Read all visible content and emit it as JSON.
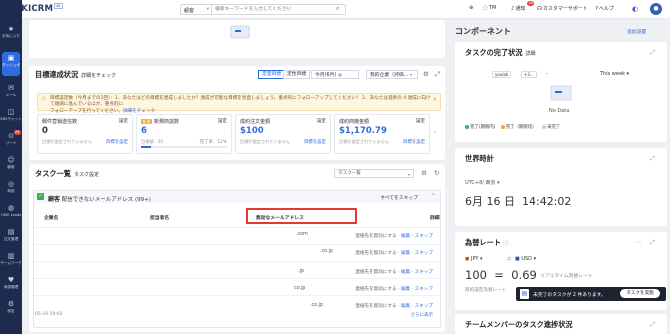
{
  "app": {
    "logo": "OKKICRM",
    "logo_badge": "AI"
  },
  "search": {
    "scope": "顧客",
    "placeholder": "検索キーワードを入力してください"
  },
  "topbar": {
    "tm": "TM",
    "notifications": "通知",
    "notification_count": "30",
    "support": "カスタマーサポート",
    "help": "ヘルプ"
  },
  "sidebar": {
    "items": [
      {
        "label": "お気に入り",
        "icon": "star-icon"
      },
      {
        "label": "ダッシュボード",
        "icon": "dashboard-icon"
      },
      {
        "label": "メール",
        "icon": "mail-icon"
      },
      {
        "label": "SNSチャット",
        "icon": "chat-icon"
      },
      {
        "label": "リード",
        "icon": "lead-icon",
        "badge": "25"
      },
      {
        "label": "顧客",
        "icon": "customer-icon"
      },
      {
        "label": "商談",
        "icon": "deal-icon"
      },
      {
        "label": "OKKI Leads",
        "icon": "leads-icon"
      },
      {
        "label": "注文管理",
        "icon": "order-icon"
      },
      {
        "label": "チームワーク",
        "icon": "team-icon"
      },
      {
        "label": "承認管理",
        "icon": "approval-icon"
      },
      {
        "label": "設定",
        "icon": "settings-icon"
      }
    ]
  },
  "goals": {
    "title": "目標達成状況",
    "subtitle": "詳細をチェック",
    "tabs": [
      "定量目標",
      "定性目標"
    ],
    "period": "今月(6月)",
    "company": "我的企業（評価...",
    "notice_line1": "目標設定数（今月までの1回）：1、あなたはどの目標を達成しましたか？達成が可能な目標を見直しましょう。重点的にフォローアップしてください！ 2、あなたは進捗の 4 達成に向けて順調に進んでいるほか、重点的に",
    "notice_line2": "フォローアップを行ってください。",
    "notice_link": "詳細をチェック",
    "metrics": [
      {
        "name": "郵件营销送信数",
        "new": false,
        "value": "0",
        "note": "目標が設定されていません",
        "link": "目標を設定",
        "settings": "設定",
        "progress": 0
      },
      {
        "name": "新規商談数",
        "new": true,
        "new_label": "新規",
        "value": "6",
        "note": "目標値：50",
        "progress_label": "完了率：12%",
        "settings": "設定",
        "progress": 0.12
      },
      {
        "name": "成約注文金額",
        "new": false,
        "value": "$100",
        "note": "目標が設定されていません",
        "link": "目標を設定",
        "settings": "設定",
        "progress": 0
      },
      {
        "name": "成約商機金額",
        "new": false,
        "value": "$1,170.79",
        "note": "目標が設定されていません",
        "link": "目標を設定",
        "settings": "設定",
        "progress": 0
      }
    ]
  },
  "tasks": {
    "title": "タスク一覧",
    "subtitle": "タスク設定",
    "filter_placeholder": "タスク一覧",
    "group_type": "顧客",
    "group_title": "配信できないメールアドレス (99+)",
    "skip_all": "すべてをスキップ",
    "columns": [
      "企業名",
      "担当者名",
      "無効なメールアドレス",
      "詳細"
    ],
    "rows": [
      {
        "domain": ".com",
        "actions": [
          "連絡先を無効にする",
          "編集",
          "スキップ"
        ]
      },
      {
        "domain": ".co.jp",
        "actions": [
          "連絡先を無効にする",
          "編集",
          "スキップ"
        ]
      },
      {
        "domain": ".jp",
        "actions": [
          "連絡先を無効にする",
          "編集",
          "スキップ"
        ]
      },
      {
        "domain": "co.jp",
        "actions": [
          "連絡先を無効にする",
          "編集",
          "スキップ"
        ]
      },
      {
        "domain": ".co.jp",
        "actions": [
          "連絡先を無効にする",
          "編集",
          "スキップ"
        ]
      }
    ],
    "date": "05-16 19:03",
    "more": "さらに表示"
  },
  "components": {
    "title": "コンポーネント",
    "add": "追加設置",
    "task_status": {
      "title": "タスクの完了状況",
      "subtitle": "詳細",
      "chips": [
        "youlak",
        "+3..."
      ],
      "dash": "-",
      "range": "This week",
      "empty": "No Data",
      "legend": [
        "完了(期限内)",
        "完了（期限切）",
        "未完了"
      ],
      "legend_colors": [
        "#37b24d",
        "#f6a623",
        "#c8ccd4"
      ]
    },
    "world_time": {
      "title": "世界時計",
      "zone": "UTC+8/ 東京",
      "date": "6月 16 日",
      "time": "14:42:02"
    },
    "fx": {
      "title": "為替レート",
      "from": "JPY",
      "to": "USD",
      "amount_from": "100",
      "eq": "=",
      "amount_to": "0.69",
      "label": "リアルタイム為替レート",
      "sub_label": "目的設定為替レート"
    },
    "team_task": {
      "title": "チームメンバーのタスク進捗状況"
    }
  },
  "reminder": {
    "text": "未完了のタスクが 2 件あります。",
    "button": "タスクを実施"
  }
}
